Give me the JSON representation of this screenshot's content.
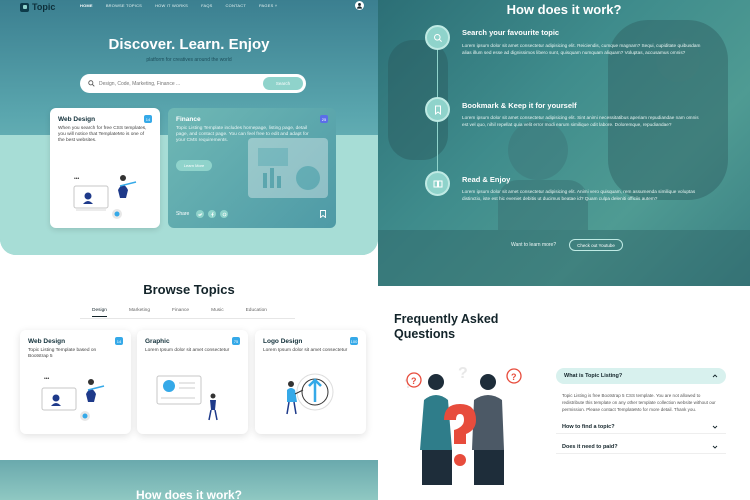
{
  "nav": {
    "brand": "Topic",
    "links": [
      "HOME",
      "BROWSE TOPICS",
      "HOW IT WORKS",
      "FAQS",
      "CONTACT",
      "PAGES ˅"
    ]
  },
  "hero": {
    "title": "Discover. Learn. Enjoy",
    "subtitle": "platform for creatives around the world",
    "search_placeholder": "Design, Code, Marketing, Finance ...",
    "search_button": "Search"
  },
  "featured": {
    "web_design": {
      "title": "Web Design",
      "badge": "14",
      "text": "When you search for free CSS templates, you will notice that TemplateMo is one of the best websites."
    },
    "finance": {
      "title": "Finance",
      "badge": "25",
      "text": "Topic Listing Template includes homepage, listing page, detail page, and contact page. You can feel free to edit and adapt for your CMS requirements.",
      "button": "Learn More",
      "share_label": "Share"
    }
  },
  "browse": {
    "title": "Browse Topics",
    "tabs": [
      "Design",
      "Marketing",
      "Finance",
      "Music",
      "Education"
    ],
    "cards": [
      {
        "title": "Web Design",
        "badge": "14",
        "text": "Topic Listing Template based on Bootstrap 5"
      },
      {
        "title": "Graphic",
        "badge": "75",
        "text": "Lorem Ipsum dolor sit amet consectetur"
      },
      {
        "title": "Logo Design",
        "badge": "100",
        "text": "Lorem Ipsum dolor sit amet consectetur"
      }
    ],
    "bottom_title": "How does it work?"
  },
  "how": {
    "title": "How does it work?",
    "steps": [
      {
        "title": "Search your favourite topic",
        "text": "Lorem ipsum dolor sit amet consectetur adipisicing elit. Reiciendis, cumque magnam? Sequi, cupiditate quibusdam alias illum sed esse ad dignissimos libero sunt, quisquam numquam aliquam? Voluptas, accusamus omnis?"
      },
      {
        "title": "Bookmark & Keep it for yourself",
        "text": "Lorem ipsum dolor sit amet consectetur adipisicing elit. Sint animi necessitatibus aperiam repudiandae nam omnis est vel quo, nihil repellat quia velit error modi earum similique odit labore. Doloremque, repudiandae?"
      },
      {
        "title": "Read & Enjoy",
        "text": "Lorem ipsum dolor sit amet consectetur adipisicing elit. Animi vero quisquam, rem assumenda similique voluptas distinctio, iste est hic eveniet debitis ut ducimus beatae id? Quam culpa deleniti officiis autem?"
      }
    ],
    "learn_more": "Want to learn more?",
    "youtube_button": "Check out Youtube"
  },
  "faq": {
    "title": "Frequently Asked Questions",
    "open_question": "What is Topic Listing?",
    "answer": "Topic Listing is free Bootstrap 5 CSS template. You are not allowed to redistribute this template on any other template collection website without our permission. Please contact TemplateMo for more detail. Thank you.",
    "questions": [
      "How to find a topic?",
      "Does it need to paid?"
    ]
  },
  "colors": {
    "accent": "#8fd3cb",
    "dark": "#13242a",
    "badge": "#35a9e8"
  }
}
